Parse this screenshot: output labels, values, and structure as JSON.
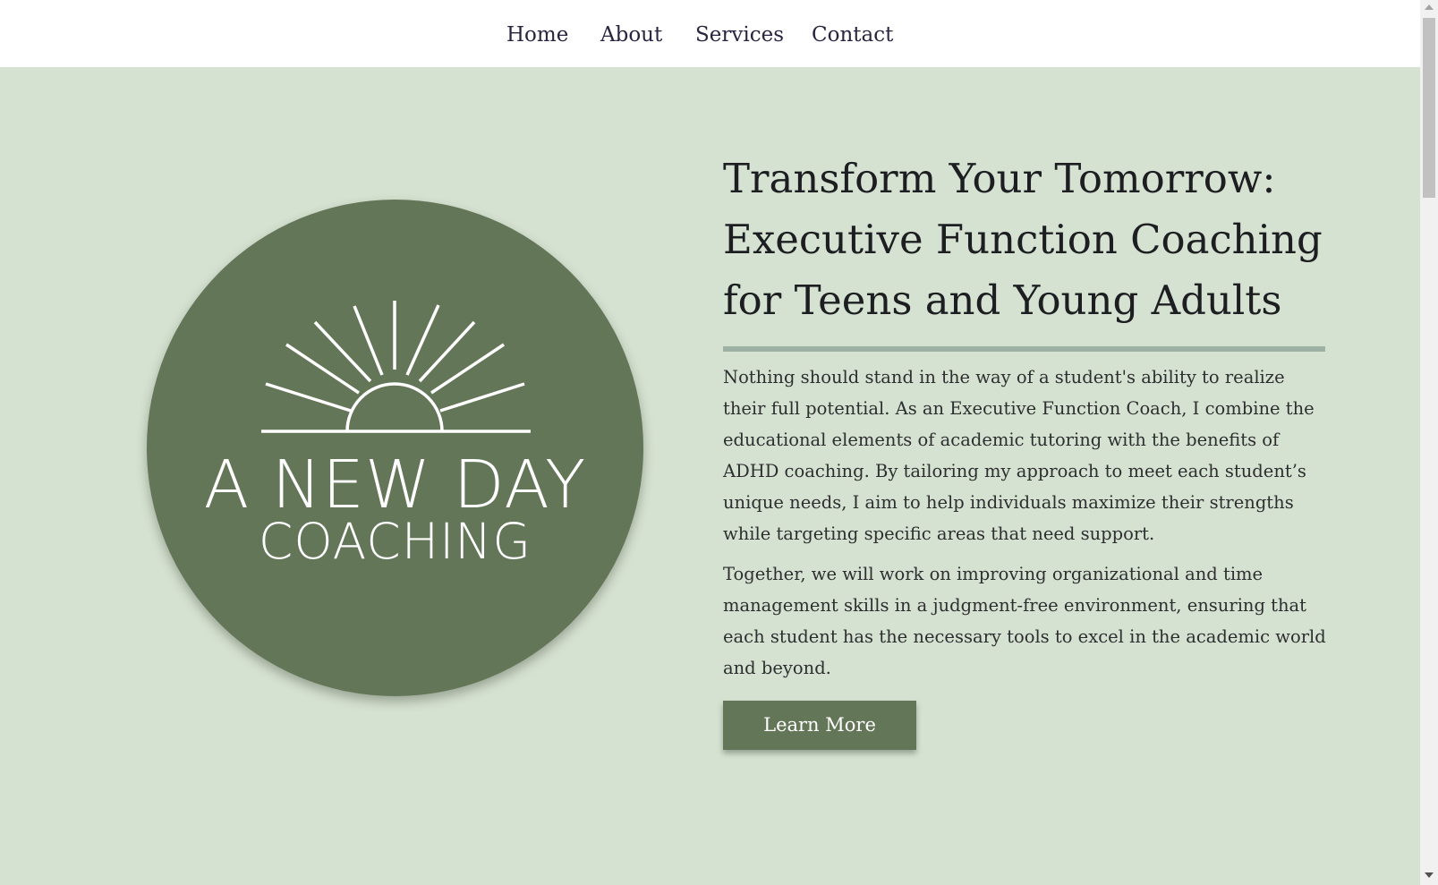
{
  "nav": {
    "items": [
      {
        "label": "Home"
      },
      {
        "label": "About"
      },
      {
        "label": "Services"
      },
      {
        "label": "Contact"
      }
    ]
  },
  "logo": {
    "title": "A NEW DAY",
    "subtitle": "COACHING",
    "icon": "sunrise-icon"
  },
  "hero": {
    "headline": "Transform Your Tomorrow: Executive Function Coaching for Teens and Young Adults",
    "paragraphs": [
      "Nothing should stand in the way of a student's ability to realize their full potential. As an Executive Function Coach, I combine the educational elements of academic tutoring with the benefits of ADHD coaching. By tailoring my approach to meet each student’s unique needs, I aim to help individuals maximize their strengths while targeting specific areas that need support.",
      "Together, we will work on improving organizational and time management skills in a judgment-free environment, ensuring that each student has the necessary tools to excel in the academic world and beyond."
    ],
    "cta_label": "Learn More"
  },
  "colors": {
    "hero_background": "#d6e2d1",
    "brand_green": "#647658",
    "rule": "#9db2a5",
    "nav_text": "#2a2440"
  }
}
